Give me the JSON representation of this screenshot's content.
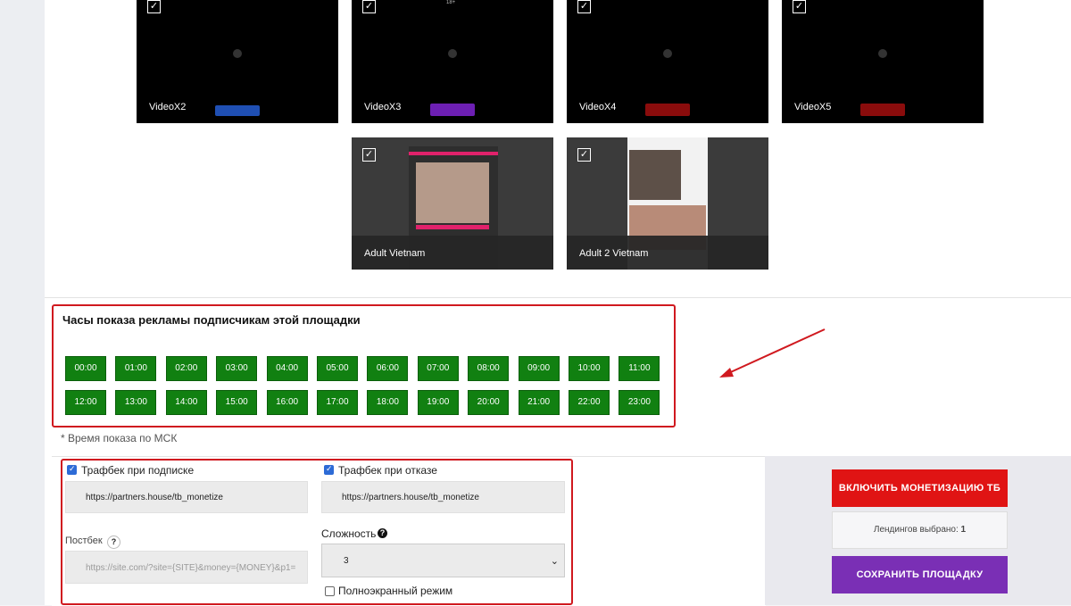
{
  "thumbnails": [
    {
      "label": "VideoX2",
      "checked_glyph": "✓",
      "button_color": "#1f4fb3"
    },
    {
      "label": "VideoX3",
      "checked_glyph": "✓",
      "button_color": "#6d1fb3",
      "top_mark": "18+"
    },
    {
      "label": "VideoX4",
      "checked_glyph": "✓",
      "button_color": "#8a0c0c"
    },
    {
      "label": "VideoX5",
      "checked_glyph": "✓",
      "button_color": "#8a0c0c"
    },
    {
      "label": "Adult Vietnam",
      "checked_glyph": "✓"
    },
    {
      "label": "Adult 2 Vietnam",
      "checked_glyph": "✓"
    }
  ],
  "hours": {
    "title": "Часы показа рекламы подписчикам этой площадки",
    "slots": [
      "00:00",
      "01:00",
      "02:00",
      "03:00",
      "04:00",
      "05:00",
      "06:00",
      "07:00",
      "08:00",
      "09:00",
      "10:00",
      "11:00",
      "12:00",
      "13:00",
      "14:00",
      "15:00",
      "16:00",
      "17:00",
      "18:00",
      "19:00",
      "20:00",
      "21:00",
      "22:00",
      "23:00"
    ],
    "active_color": "#118011",
    "note": "* Время показа по МСК"
  },
  "form": {
    "trafback_subscribe": {
      "label": "Трафбек при подписке",
      "checked": true,
      "value": "https://partners.house/tb_monetize"
    },
    "trafback_refuse": {
      "label": "Трафбек при отказе",
      "checked": true,
      "value": "https://partners.house/tb_monetize"
    },
    "postback": {
      "label": "Постбек",
      "help": "?",
      "placeholder": "https://site.com/?site={SITE}&money={MONEY}&p1="
    },
    "difficulty": {
      "label": "Сложность",
      "help": "?",
      "value": "3"
    },
    "fullscreen": {
      "label": "Полноэкранный режим",
      "checked": false
    }
  },
  "actions": {
    "enable_monetization": "ВКЛЮЧИТЬ МОНЕТИЗАЦИЮ ТБ",
    "landings_label": "Лендингов выбрано:",
    "landings_count": "1",
    "save_site": "СОХРАНИТЬ ПЛОЩАДКУ"
  },
  "colors": {
    "highlight_border": "#d0191f",
    "red_button": "#e01414",
    "purple_button": "#7a2fb5"
  }
}
